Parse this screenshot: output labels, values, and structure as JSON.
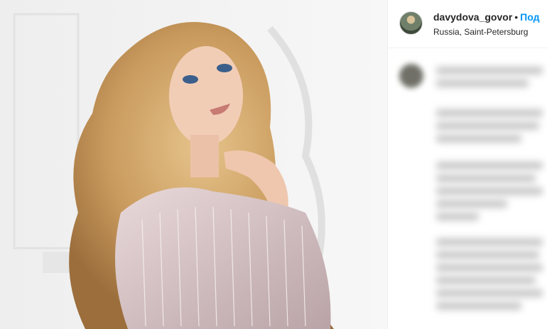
{
  "post": {
    "username": "davydova_govor",
    "separator": "•",
    "follow_label": "Под",
    "location": "Russia, Saint-Petersburg"
  },
  "colors": {
    "link": "#0095f6",
    "text": "#262626",
    "divider": "#efefef"
  },
  "icons": {
    "avatar": "profile-avatar",
    "blurred": "blurred-comment-text"
  }
}
